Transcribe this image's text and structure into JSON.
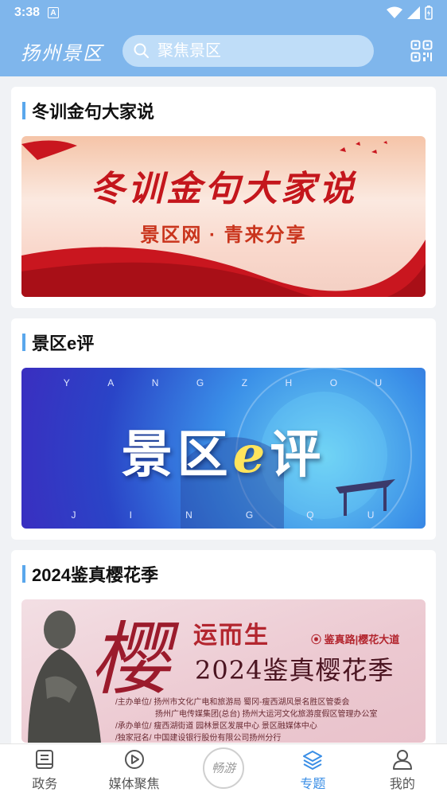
{
  "status": {
    "time": "3:38",
    "badge": "A"
  },
  "header": {
    "logo": "扬州景区",
    "search_placeholder": "聚焦景区"
  },
  "sections": [
    {
      "title": "冬训金句大家说",
      "banner_title": "冬训金句大家说",
      "banner_subtitle": "景区网 · 青来分享"
    },
    {
      "title": "景区e评",
      "banner_title_pre": "景区",
      "banner_title_e": "e",
      "banner_title_post": "评",
      "top_letters": [
        "Y",
        "A",
        "N",
        "G",
        "Z",
        "H",
        "O",
        "U"
      ],
      "bottom_letters": [
        "J",
        "I",
        "N",
        "G",
        "Q",
        "U"
      ]
    },
    {
      "title": "2024鉴真樱花季",
      "banner_big": "樱",
      "banner_yun": "运而生",
      "banner_tag": "鉴真路|樱花大道",
      "banner_title": "2024鉴真樱花季",
      "info": [
        "/主办单位/ 扬州市文化广电和旅游局  蜀冈-瘦西湖风景名胜区管委会",
        "扬州广电传媒集团(总台)  扬州大运河文化旅游度假区管理办公室",
        "/承办单位/ 瘦西湖街道  园林景区发展中心  景区融媒体中心",
        "/独家冠名/ 中国建设银行股份有限公司扬州分行"
      ]
    }
  ],
  "nav": [
    {
      "label": "政务",
      "icon": "document-icon"
    },
    {
      "label": "媒体聚焦",
      "icon": "play-icon"
    },
    {
      "label": "畅游",
      "icon": "changyou-logo"
    },
    {
      "label": "专题",
      "icon": "layers-icon",
      "active": true
    },
    {
      "label": "我的",
      "icon": "person-icon"
    }
  ],
  "colors": {
    "header": "#7fb6ec",
    "accent": "#3a8ee6",
    "title_bar": "#5aa7ec"
  }
}
